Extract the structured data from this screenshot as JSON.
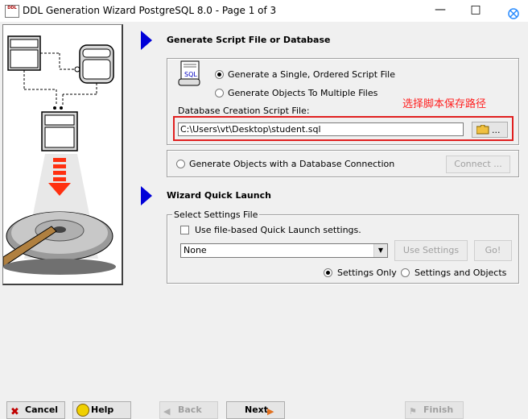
{
  "window": {
    "title": "DDL Generation Wizard PostgreSQL 8.0 - Page 1 of 3",
    "icon_text": "DDL"
  },
  "section1": {
    "title": "Generate Script File or Database",
    "script_icon_text": "SQL",
    "radio_single": "Generate a Single, Ordered Script File",
    "radio_single_selected": true,
    "radio_multiple": "Generate Objects To Multiple Files",
    "radio_multiple_selected": false,
    "script_file_label": "Database Creation Script File:",
    "script_file_value": "C:\\Users\\vt\\Desktop\\student.sql",
    "browse_label": "...",
    "annotation": "选择脚本保存路径"
  },
  "connection": {
    "radio_label": "Generate Objects with a Database Connection",
    "radio_selected": false,
    "connect_button": "Connect ..."
  },
  "section2": {
    "title": "Wizard Quick Launch",
    "group_label": "Select Settings File",
    "checkbox_label": "Use file-based Quick Launch settings.",
    "checkbox_checked": false,
    "select_value": "None",
    "use_settings_button": "Use Settings",
    "go_button": "Go!",
    "radio_settings_only": "Settings Only",
    "radio_settings_only_selected": true,
    "radio_settings_objects": "Settings and Objects",
    "radio_settings_objects_selected": false
  },
  "footer": {
    "cancel": "Cancel",
    "help": "Help",
    "back": "Back",
    "next": "Next",
    "finish": "Finish"
  },
  "colors": {
    "accent_arrow": "#0000d8",
    "annotation_red": "#ff2020"
  }
}
